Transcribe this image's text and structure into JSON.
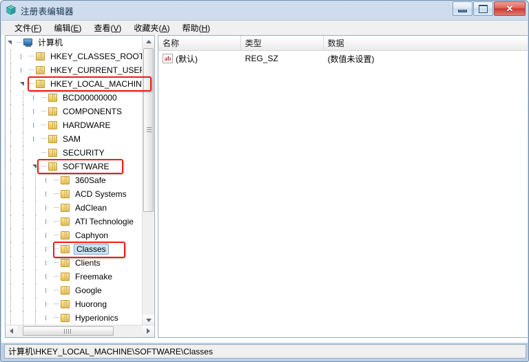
{
  "window": {
    "title": "注册表编辑器",
    "icon": "registry-cube-icon",
    "controls": {
      "minimize": "最小化",
      "maximize": "最大化",
      "close": "✕"
    }
  },
  "menubar": {
    "items": [
      {
        "label": "文件",
        "accel": "F"
      },
      {
        "label": "编辑",
        "accel": "E"
      },
      {
        "label": "查看",
        "accel": "V"
      },
      {
        "label": "收藏夹",
        "accel": "A"
      },
      {
        "label": "帮助",
        "accel": "H"
      }
    ]
  },
  "tree": {
    "nodes": [
      {
        "label": "计算机",
        "depth": 0,
        "state": "expanded",
        "icon": "computer-icon",
        "selected": false,
        "highlight": false
      },
      {
        "label": "HKEY_CLASSES_ROOT",
        "depth": 1,
        "state": "collapsed",
        "icon": "folder-icon",
        "selected": false,
        "highlight": false
      },
      {
        "label": "HKEY_CURRENT_USER",
        "depth": 1,
        "state": "collapsed",
        "icon": "folder-icon",
        "selected": false,
        "highlight": false
      },
      {
        "label": "HKEY_LOCAL_MACHINE",
        "depth": 1,
        "state": "expanded",
        "icon": "folder-icon",
        "selected": false,
        "highlight": true
      },
      {
        "label": "BCD00000000",
        "depth": 2,
        "state": "collapsed",
        "icon": "folder-icon",
        "selected": false,
        "highlight": false
      },
      {
        "label": "COMPONENTS",
        "depth": 2,
        "state": "collapsed",
        "icon": "folder-icon",
        "selected": false,
        "highlight": false
      },
      {
        "label": "HARDWARE",
        "depth": 2,
        "state": "collapsed",
        "icon": "folder-icon",
        "selected": false,
        "highlight": false
      },
      {
        "label": "SAM",
        "depth": 2,
        "state": "collapsed",
        "icon": "folder-icon",
        "selected": false,
        "highlight": false
      },
      {
        "label": "SECURITY",
        "depth": 2,
        "state": "leaf",
        "icon": "folder-icon",
        "selected": false,
        "highlight": false
      },
      {
        "label": "SOFTWARE",
        "depth": 2,
        "state": "expanded",
        "icon": "folder-icon",
        "selected": false,
        "highlight": true
      },
      {
        "label": "360Safe",
        "depth": 3,
        "state": "collapsed",
        "icon": "folder-icon",
        "selected": false,
        "highlight": false
      },
      {
        "label": "ACD Systems",
        "depth": 3,
        "state": "collapsed",
        "icon": "folder-icon",
        "selected": false,
        "highlight": false
      },
      {
        "label": "AdClean",
        "depth": 3,
        "state": "collapsed",
        "icon": "folder-icon",
        "selected": false,
        "highlight": false
      },
      {
        "label": "ATI Technologie",
        "depth": 3,
        "state": "collapsed",
        "icon": "folder-icon",
        "selected": false,
        "highlight": false
      },
      {
        "label": "Caphyon",
        "depth": 3,
        "state": "collapsed",
        "icon": "folder-icon",
        "selected": false,
        "highlight": false
      },
      {
        "label": "Classes",
        "depth": 3,
        "state": "collapsed",
        "icon": "folder-icon",
        "selected": true,
        "highlight": true
      },
      {
        "label": "Clients",
        "depth": 3,
        "state": "collapsed",
        "icon": "folder-icon",
        "selected": false,
        "highlight": false
      },
      {
        "label": "Freemake",
        "depth": 3,
        "state": "collapsed",
        "icon": "folder-icon",
        "selected": false,
        "highlight": false
      },
      {
        "label": "Google",
        "depth": 3,
        "state": "collapsed",
        "icon": "folder-icon",
        "selected": false,
        "highlight": false
      },
      {
        "label": "Huorong",
        "depth": 3,
        "state": "collapsed",
        "icon": "folder-icon",
        "selected": false,
        "highlight": false
      },
      {
        "label": "Hyperionics",
        "depth": 3,
        "state": "collapsed",
        "icon": "folder-icon",
        "selected": false,
        "highlight": false
      }
    ]
  },
  "list": {
    "columns": [
      "名称",
      "类型",
      "数据"
    ],
    "rows": [
      {
        "name": "(默认)",
        "type": "REG_SZ",
        "data": "(数值未设置)",
        "icon": "string-value-icon"
      }
    ]
  },
  "statusbar": {
    "path": "计算机\\HKEY_LOCAL_MACHINE\\SOFTWARE\\Classes"
  },
  "annotations": {
    "accent_color": "#ee1c18",
    "boxes": [
      {
        "target": "HKEY_LOCAL_MACHINE"
      },
      {
        "target": "SOFTWARE"
      },
      {
        "target": "Classes"
      }
    ]
  }
}
